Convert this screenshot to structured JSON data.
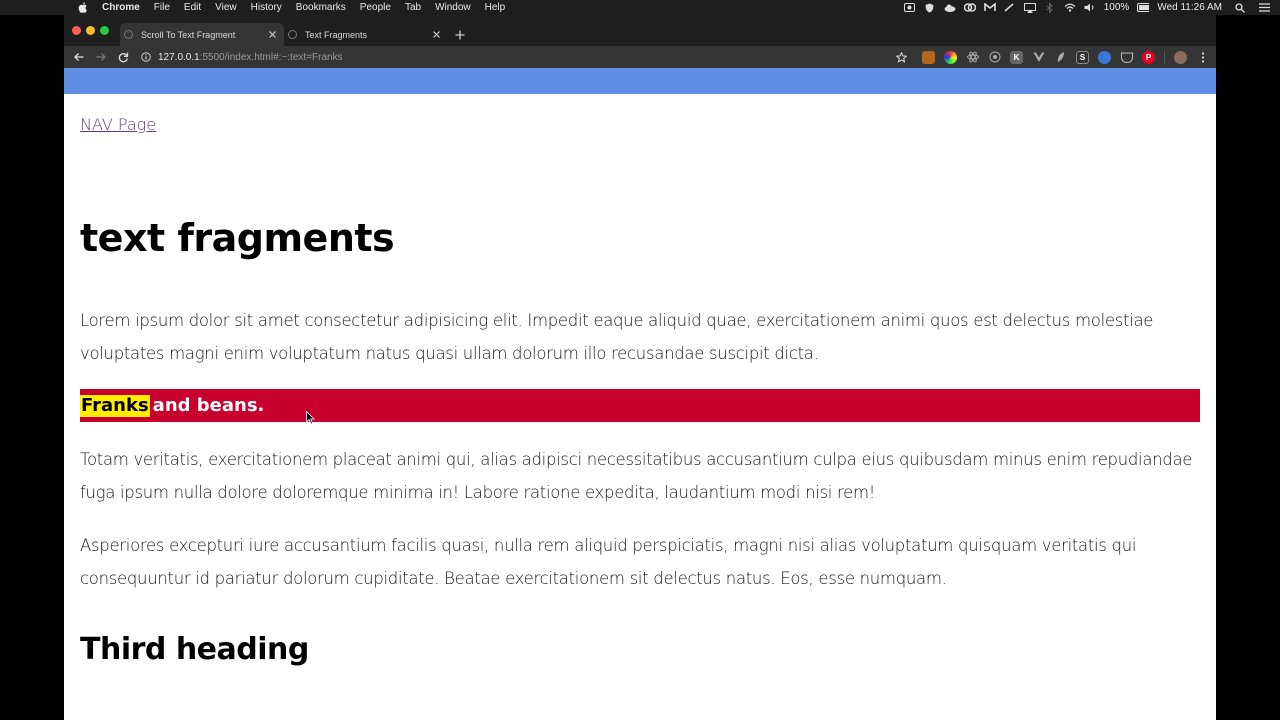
{
  "menubar": {
    "app": "Chrome",
    "items": [
      "File",
      "Edit",
      "View",
      "History",
      "Bookmarks",
      "People",
      "Tab",
      "Window",
      "Help"
    ],
    "battery": "100%",
    "clock": "Wed 11:26 AM"
  },
  "browser": {
    "tabs": [
      {
        "label": "Scroll To Text Fragment",
        "active": true
      },
      {
        "label": "Text Fragments",
        "active": false
      }
    ],
    "url_host": "127.0.0.1",
    "url_rest": ":5500/index.html#:~:text=Franks"
  },
  "page": {
    "nav_link": "NAV Page",
    "heading": "text fragments",
    "para1": "Lorem ipsum dolor sit amet consectetur adipisicing elit. Impedit eaque aliquid quae, exercitationem animi quos est delectus molestiae voluptates magni enim voluptatum natus quasi ullam dolorum illo recusandae suscipit dicta.",
    "highlight_word": "Franks",
    "highlight_rest": "and beans.",
    "para2": "Totam veritatis, exercitationem placeat animi qui, alias adipisci necessitatibus accusantium culpa eius quibusdam minus enim repudiandae fuga ipsum nulla dolore doloremque minima in! Labore ratione expedita, laudantium modi nisi rem!",
    "para3": "Asperiores excepturi iure accusantium facilis quasi, nulla rem aliquid perspiciatis, magni nisi alias voluptatum quisquam veritatis qui consequuntur id pariatur dolorum cupiditate. Beatae exercitationem sit delectus natus. Eos, esse numquam.",
    "heading2": "Third heading"
  },
  "colors": {
    "topbar": "#5e8ee6",
    "band": "#c7002d",
    "highlight": "#ffee00"
  }
}
